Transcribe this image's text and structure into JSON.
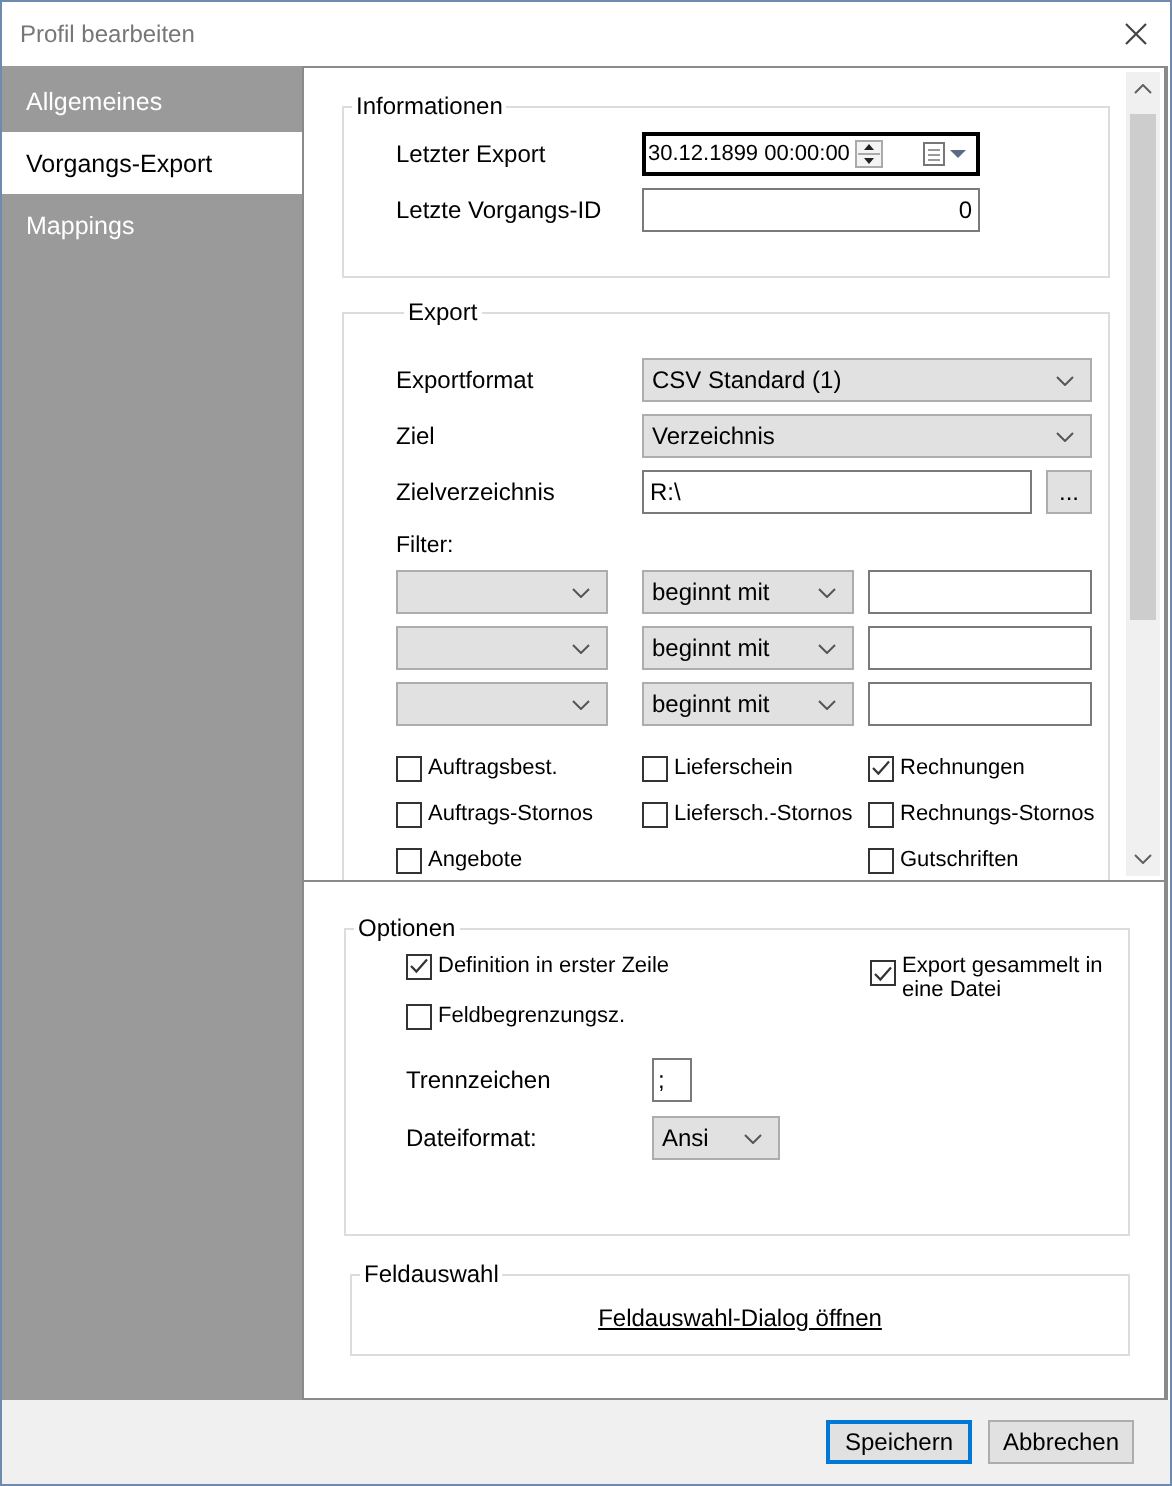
{
  "window": {
    "title": "Profil bearbeiten"
  },
  "sidebar": {
    "items": [
      {
        "label": "Allgemeines",
        "selected": false
      },
      {
        "label": "Vorgangs-Export",
        "selected": true
      },
      {
        "label": "Mappings",
        "selected": false
      }
    ]
  },
  "informationen": {
    "title": "Informationen",
    "fields": [
      {
        "label": "Letzter Export",
        "kind": "datetime",
        "value": "30.12.1899 00:00:00"
      },
      {
        "label": "Letzte Vorgangs-ID",
        "kind": "number",
        "value": "0"
      }
    ]
  },
  "export": {
    "title": "Export",
    "fields": [
      {
        "label": "Exportformat",
        "kind": "select",
        "value": "CSV Standard (1)"
      },
      {
        "label": "Ziel",
        "kind": "select",
        "value": "Verzeichnis"
      },
      {
        "label": "Zielverzeichnis",
        "kind": "path",
        "value": "R:\\",
        "button": "..."
      }
    ],
    "filter_label": "Filter:",
    "filters": [
      {
        "operator": "beginnt mit"
      },
      {
        "operator": "beginnt mit"
      },
      {
        "operator": "beginnt mit"
      }
    ],
    "document_types": [
      [
        {
          "label": "Auftragsbest.",
          "checked": false
        },
        {
          "label": "Auftrags-Stornos",
          "checked": false
        },
        {
          "label": "Angebote",
          "checked": false
        }
      ],
      [
        {
          "label": "Lieferschein",
          "checked": false
        },
        {
          "label": "Liefersch.-Stornos",
          "checked": false
        }
      ],
      [
        {
          "label": "Rechnungen",
          "checked": true
        },
        {
          "label": "Rechnungs-Stornos",
          "checked": false
        },
        {
          "label": "Gutschriften",
          "checked": false
        }
      ]
    ]
  },
  "optionen": {
    "title": "Optionen",
    "checkboxes": [
      {
        "label": "Definition in erster Zeile",
        "checked": true
      },
      {
        "label": "Feldbegrenzungsz.",
        "checked": false
      }
    ],
    "collect": {
      "label": "Export gesammelt in eine Datei",
      "checked": true
    },
    "separator": {
      "label": "Trennzeichen",
      "value": ";"
    },
    "file_format": {
      "label": "Dateiformat:",
      "value": "Ansi"
    }
  },
  "feldauswahl": {
    "title": "Feldauswahl",
    "link": "Feldauswahl-Dialog öffnen"
  },
  "buttons": [
    {
      "label": "Speichern",
      "default": true
    },
    {
      "label": "Abbrechen",
      "default": false
    }
  ]
}
